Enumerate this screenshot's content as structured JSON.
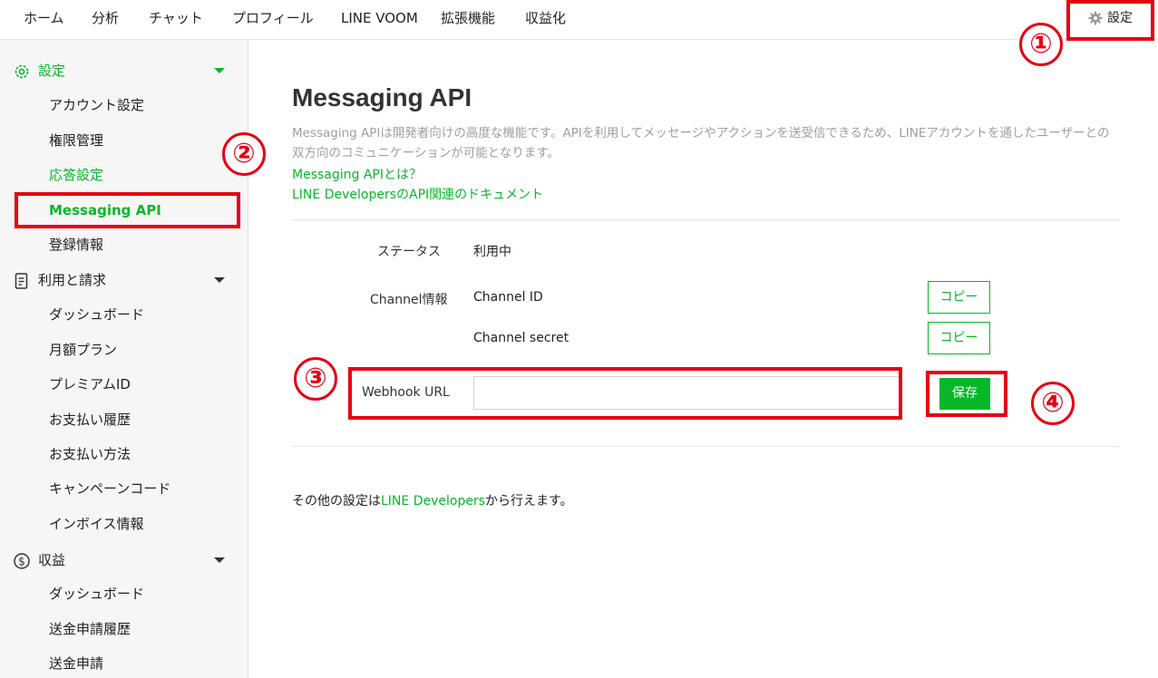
{
  "topnav": {
    "items": [
      "ホーム",
      "分析",
      "チャット",
      "プロフィール",
      "LINE VOOM",
      "拡張機能",
      "収益化"
    ],
    "settings_label": "設定"
  },
  "sidebar": {
    "settings_section": "設定",
    "settings_items": [
      "アカウント設定",
      "権限管理",
      "応答設定",
      "Messaging API",
      "登録情報"
    ],
    "billing_section": "利用と請求",
    "billing_items": [
      "ダッシュボード",
      "月額プラン",
      "プレミアムID",
      "お支払い履歴",
      "お支払い方法",
      "キャンペーンコード",
      "インボイス情報"
    ],
    "revenue_section": "収益",
    "revenue_items": [
      "ダッシュボード",
      "送金申請履歴",
      "送金申請"
    ]
  },
  "main": {
    "title": "Messaging API",
    "description": "Messaging APIは開発者向けの高度な機能です。APIを利用してメッセージやアクションを送受信できるため、LINEアカウントを通したユーザーとの双方向のコミュニケーションが可能となります。",
    "link1": "Messaging APIとは？",
    "link2": "LINE DevelopersのAPI関連のドキュメント",
    "status_label": "ステータス",
    "status_value": "利用中",
    "channel_label": "Channel情報",
    "channel_id_label": "Channel ID",
    "channel_secret_label": "Channel secret",
    "copy_label": "コピー",
    "webhook_label": "Webhook URL",
    "webhook_value": "",
    "save_label": "保存",
    "footer_before": "その他の設定は",
    "footer_link": "LINE Developers",
    "footer_after": "から行えます。"
  },
  "annotations": [
    "①",
    "②",
    "③",
    "④"
  ],
  "colors": {
    "accent": "#06b729",
    "annotation": "#e60012"
  }
}
